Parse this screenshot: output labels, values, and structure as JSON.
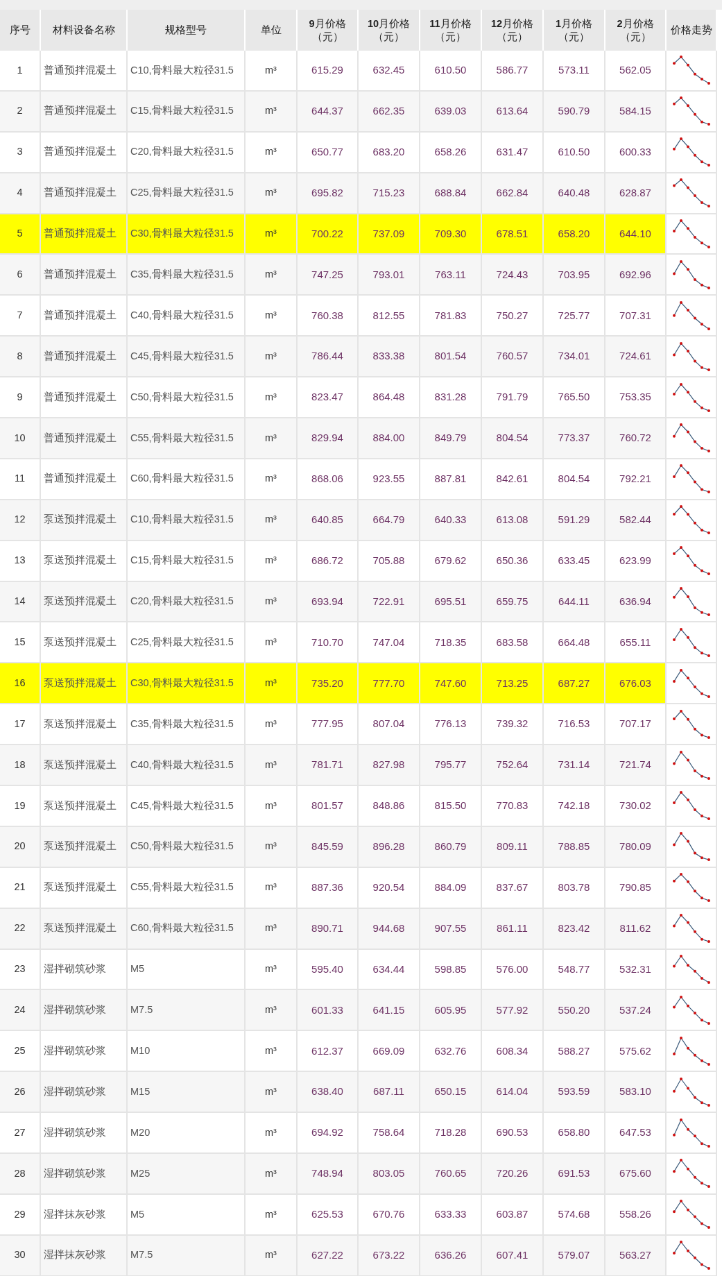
{
  "table": {
    "columns": [
      {
        "label": "序号"
      },
      {
        "label": "材料设备名称"
      },
      {
        "label": "规格型号"
      },
      {
        "label": "单位"
      },
      {
        "label": "**9**月价格",
        "unit": "（元）"
      },
      {
        "label": "**10**月价格",
        "unit": "（元）"
      },
      {
        "label": "**11**月价格",
        "unit": "（元）"
      },
      {
        "label": "**12**月价格",
        "unit": "（元）"
      },
      {
        "label": "**1**月价格",
        "unit": "（元）"
      },
      {
        "label": "**2**月价格",
        "unit": "（元）"
      },
      {
        "label": "价格走势"
      }
    ],
    "rows": [
      {
        "no": "1",
        "name": "普通预拌混凝土",
        "spec": "C10,骨料最大粒径31.5",
        "unit": "m³",
        "prices": [
          "615.29",
          "632.45",
          "610.50",
          "586.77",
          "573.11",
          "562.05"
        ],
        "highlighted": false
      },
      {
        "no": "2",
        "name": "普通预拌混凝土",
        "spec": "C15,骨料最大粒径31.5",
        "unit": "m³",
        "prices": [
          "644.37",
          "662.35",
          "639.03",
          "613.64",
          "590.79",
          "584.15"
        ],
        "highlighted": false
      },
      {
        "no": "3",
        "name": "普通预拌混凝土",
        "spec": "C20,骨料最大粒径31.5",
        "unit": "m³",
        "prices": [
          "650.77",
          "683.20",
          "658.26",
          "631.47",
          "610.50",
          "600.33"
        ],
        "highlighted": false
      },
      {
        "no": "4",
        "name": "普通预拌混凝土",
        "spec": "C25,骨料最大粒径31.5",
        "unit": "m³",
        "prices": [
          "695.82",
          "715.23",
          "688.84",
          "662.84",
          "640.48",
          "628.87"
        ],
        "highlighted": false
      },
      {
        "no": "5",
        "name": "普通预拌混凝土",
        "spec": "C30,骨料最大粒径31.5",
        "unit": "m³",
        "prices": [
          "700.22",
          "737.09",
          "709.30",
          "678.51",
          "658.20",
          "644.10"
        ],
        "highlighted": true
      },
      {
        "no": "6",
        "name": "普通预拌混凝土",
        "spec": "C35,骨料最大粒径31.5",
        "unit": "m³",
        "prices": [
          "747.25",
          "793.01",
          "763.11",
          "724.43",
          "703.95",
          "692.96"
        ],
        "highlighted": false
      },
      {
        "no": "7",
        "name": "普通预拌混凝土",
        "spec": "C40,骨料最大粒径31.5",
        "unit": "m³",
        "prices": [
          "760.38",
          "812.55",
          "781.83",
          "750.27",
          "725.77",
          "707.31"
        ],
        "highlighted": false
      },
      {
        "no": "8",
        "name": "普通预拌混凝土",
        "spec": "C45,骨料最大粒径31.5",
        "unit": "m³",
        "prices": [
          "786.44",
          "833.38",
          "801.54",
          "760.57",
          "734.01",
          "724.61"
        ],
        "highlighted": false
      },
      {
        "no": "9",
        "name": "普通预拌混凝土",
        "spec": "C50,骨料最大粒径31.5",
        "unit": "m³",
        "prices": [
          "823.47",
          "864.48",
          "831.28",
          "791.79",
          "765.50",
          "753.35"
        ],
        "highlighted": false
      },
      {
        "no": "10",
        "name": "普通预拌混凝土",
        "spec": "C55,骨料最大粒径31.5",
        "unit": "m³",
        "prices": [
          "829.94",
          "884.00",
          "849.79",
          "804.54",
          "773.37",
          "760.72"
        ],
        "highlighted": false
      },
      {
        "no": "11",
        "name": "普通预拌混凝土",
        "spec": "C60,骨料最大粒径31.5",
        "unit": "m³",
        "prices": [
          "868.06",
          "923.55",
          "887.81",
          "842.61",
          "804.54",
          "792.21"
        ],
        "highlighted": false
      },
      {
        "no": "12",
        "name": "泵送预拌混凝土",
        "spec": "C10,骨料最大粒径31.5",
        "unit": "m³",
        "prices": [
          "640.85",
          "664.79",
          "640.33",
          "613.08",
          "591.29",
          "582.44"
        ],
        "highlighted": false
      },
      {
        "no": "13",
        "name": "泵送预拌混凝土",
        "spec": "C15,骨料最大粒径31.5",
        "unit": "m³",
        "prices": [
          "686.72",
          "705.88",
          "679.62",
          "650.36",
          "633.45",
          "623.99"
        ],
        "highlighted": false
      },
      {
        "no": "14",
        "name": "泵送预拌混凝土",
        "spec": "C20,骨料最大粒径31.5",
        "unit": "m³",
        "prices": [
          "693.94",
          "722.91",
          "695.51",
          "659.75",
          "644.11",
          "636.94"
        ],
        "highlighted": false
      },
      {
        "no": "15",
        "name": "泵送预拌混凝土",
        "spec": "C25,骨料最大粒径31.5",
        "unit": "m³",
        "prices": [
          "710.70",
          "747.04",
          "718.35",
          "683.58",
          "664.48",
          "655.11"
        ],
        "highlighted": false
      },
      {
        "no": "16",
        "name": "泵送预拌混凝土",
        "spec": "C30,骨料最大粒径31.5",
        "unit": "m³",
        "prices": [
          "735.20",
          "777.70",
          "747.60",
          "713.25",
          "687.27",
          "676.03"
        ],
        "highlighted": true
      },
      {
        "no": "17",
        "name": "泵送预拌混凝土",
        "spec": "C35,骨料最大粒径31.5",
        "unit": "m³",
        "prices": [
          "777.95",
          "807.04",
          "776.13",
          "739.32",
          "716.53",
          "707.17"
        ],
        "highlighted": false
      },
      {
        "no": "18",
        "name": "泵送预拌混凝土",
        "spec": "C40,骨料最大粒径31.5",
        "unit": "m³",
        "prices": [
          "781.71",
          "827.98",
          "795.77",
          "752.64",
          "731.14",
          "721.74"
        ],
        "highlighted": false
      },
      {
        "no": "19",
        "name": "泵送预拌混凝土",
        "spec": "C45,骨料最大粒径31.5",
        "unit": "m³",
        "prices": [
          "801.57",
          "848.86",
          "815.50",
          "770.83",
          "742.18",
          "730.02"
        ],
        "highlighted": false
      },
      {
        "no": "20",
        "name": "泵送预拌混凝土",
        "spec": "C50,骨料最大粒径31.5",
        "unit": "m³",
        "prices": [
          "845.59",
          "896.28",
          "860.79",
          "809.11",
          "788.85",
          "780.09"
        ],
        "highlighted": false
      },
      {
        "no": "21",
        "name": "泵送预拌混凝土",
        "spec": "C55,骨料最大粒径31.5",
        "unit": "m³",
        "prices": [
          "887.36",
          "920.54",
          "884.09",
          "837.67",
          "803.78",
          "790.85"
        ],
        "highlighted": false
      },
      {
        "no": "22",
        "name": "泵送预拌混凝土",
        "spec": "C60,骨料最大粒径31.5",
        "unit": "m³",
        "prices": [
          "890.71",
          "944.68",
          "907.55",
          "861.11",
          "823.42",
          "811.62"
        ],
        "highlighted": false
      },
      {
        "no": "23",
        "name": "湿拌砌筑砂浆",
        "spec": "M5",
        "unit": "m³",
        "prices": [
          "595.40",
          "634.44",
          "598.85",
          "576.00",
          "548.77",
          "532.31"
        ],
        "highlighted": false
      },
      {
        "no": "24",
        "name": "湿拌砌筑砂浆",
        "spec": "M7.5",
        "unit": "m³",
        "prices": [
          "601.33",
          "641.15",
          "605.95",
          "577.92",
          "550.20",
          "537.24"
        ],
        "highlighted": false
      },
      {
        "no": "25",
        "name": "湿拌砌筑砂浆",
        "spec": "M10",
        "unit": "m³",
        "prices": [
          "612.37",
          "669.09",
          "632.76",
          "608.34",
          "588.27",
          "575.62"
        ],
        "highlighted": false
      },
      {
        "no": "26",
        "name": "湿拌砌筑砂浆",
        "spec": "M15",
        "unit": "m³",
        "prices": [
          "638.40",
          "687.11",
          "650.15",
          "614.04",
          "593.59",
          "583.10"
        ],
        "highlighted": false
      },
      {
        "no": "27",
        "name": "湿拌砌筑砂浆",
        "spec": "M20",
        "unit": "m³",
        "prices": [
          "694.92",
          "758.64",
          "718.28",
          "690.53",
          "658.80",
          "647.53"
        ],
        "highlighted": false
      },
      {
        "no": "28",
        "name": "湿拌砌筑砂浆",
        "spec": "M25",
        "unit": "m³",
        "prices": [
          "748.94",
          "803.05",
          "760.65",
          "720.26",
          "691.53",
          "675.60"
        ],
        "highlighted": false
      },
      {
        "no": "29",
        "name": "湿拌抹灰砂浆",
        "spec": "M5",
        "unit": "m³",
        "prices": [
          "625.53",
          "670.76",
          "633.33",
          "603.87",
          "574.68",
          "558.26"
        ],
        "highlighted": false
      },
      {
        "no": "30",
        "name": "湿拌抹灰砂浆",
        "spec": "M7.5",
        "unit": "m³",
        "prices": [
          "627.22",
          "673.22",
          "636.26",
          "607.41",
          "579.07",
          "563.27"
        ],
        "highlighted": false
      }
    ]
  }
}
